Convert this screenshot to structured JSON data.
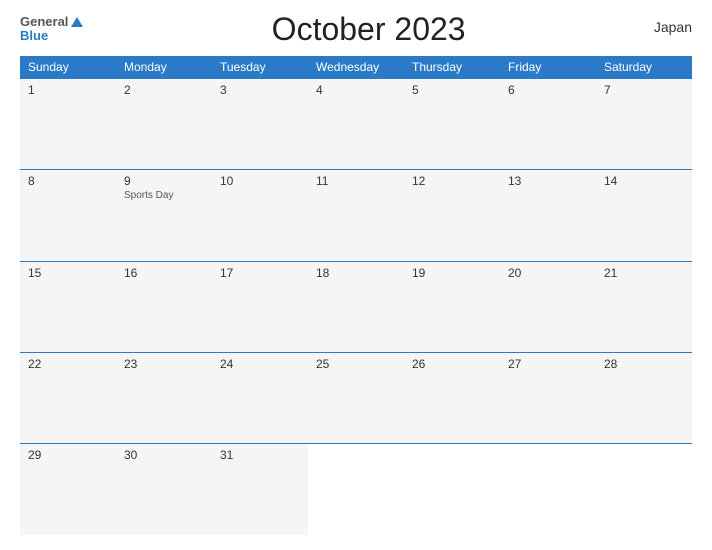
{
  "header": {
    "logo": {
      "general": "General",
      "blue": "Blue",
      "line1": "General",
      "line2": "Blue"
    },
    "title": "October 2023",
    "country": "Japan"
  },
  "days_of_week": [
    "Sunday",
    "Monday",
    "Tuesday",
    "Wednesday",
    "Thursday",
    "Friday",
    "Saturday"
  ],
  "weeks": [
    [
      {
        "day": 1,
        "holiday": ""
      },
      {
        "day": 2,
        "holiday": ""
      },
      {
        "day": 3,
        "holiday": ""
      },
      {
        "day": 4,
        "holiday": ""
      },
      {
        "day": 5,
        "holiday": ""
      },
      {
        "day": 6,
        "holiday": ""
      },
      {
        "day": 7,
        "holiday": ""
      }
    ],
    [
      {
        "day": 8,
        "holiday": ""
      },
      {
        "day": 9,
        "holiday": "Sports Day"
      },
      {
        "day": 10,
        "holiday": ""
      },
      {
        "day": 11,
        "holiday": ""
      },
      {
        "day": 12,
        "holiday": ""
      },
      {
        "day": 13,
        "holiday": ""
      },
      {
        "day": 14,
        "holiday": ""
      }
    ],
    [
      {
        "day": 15,
        "holiday": ""
      },
      {
        "day": 16,
        "holiday": ""
      },
      {
        "day": 17,
        "holiday": ""
      },
      {
        "day": 18,
        "holiday": ""
      },
      {
        "day": 19,
        "holiday": ""
      },
      {
        "day": 20,
        "holiday": ""
      },
      {
        "day": 21,
        "holiday": ""
      }
    ],
    [
      {
        "day": 22,
        "holiday": ""
      },
      {
        "day": 23,
        "holiday": ""
      },
      {
        "day": 24,
        "holiday": ""
      },
      {
        "day": 25,
        "holiday": ""
      },
      {
        "day": 26,
        "holiday": ""
      },
      {
        "day": 27,
        "holiday": ""
      },
      {
        "day": 28,
        "holiday": ""
      }
    ],
    [
      {
        "day": 29,
        "holiday": ""
      },
      {
        "day": 30,
        "holiday": ""
      },
      {
        "day": 31,
        "holiday": ""
      },
      {
        "day": null,
        "holiday": ""
      },
      {
        "day": null,
        "holiday": ""
      },
      {
        "day": null,
        "holiday": ""
      },
      {
        "day": null,
        "holiday": ""
      }
    ]
  ],
  "colors": {
    "header_bg": "#2a7ac7",
    "header_text": "#ffffff",
    "cell_bg": "#f5f5f5",
    "empty_bg": "#ffffff",
    "border": "#2a7ac7"
  }
}
